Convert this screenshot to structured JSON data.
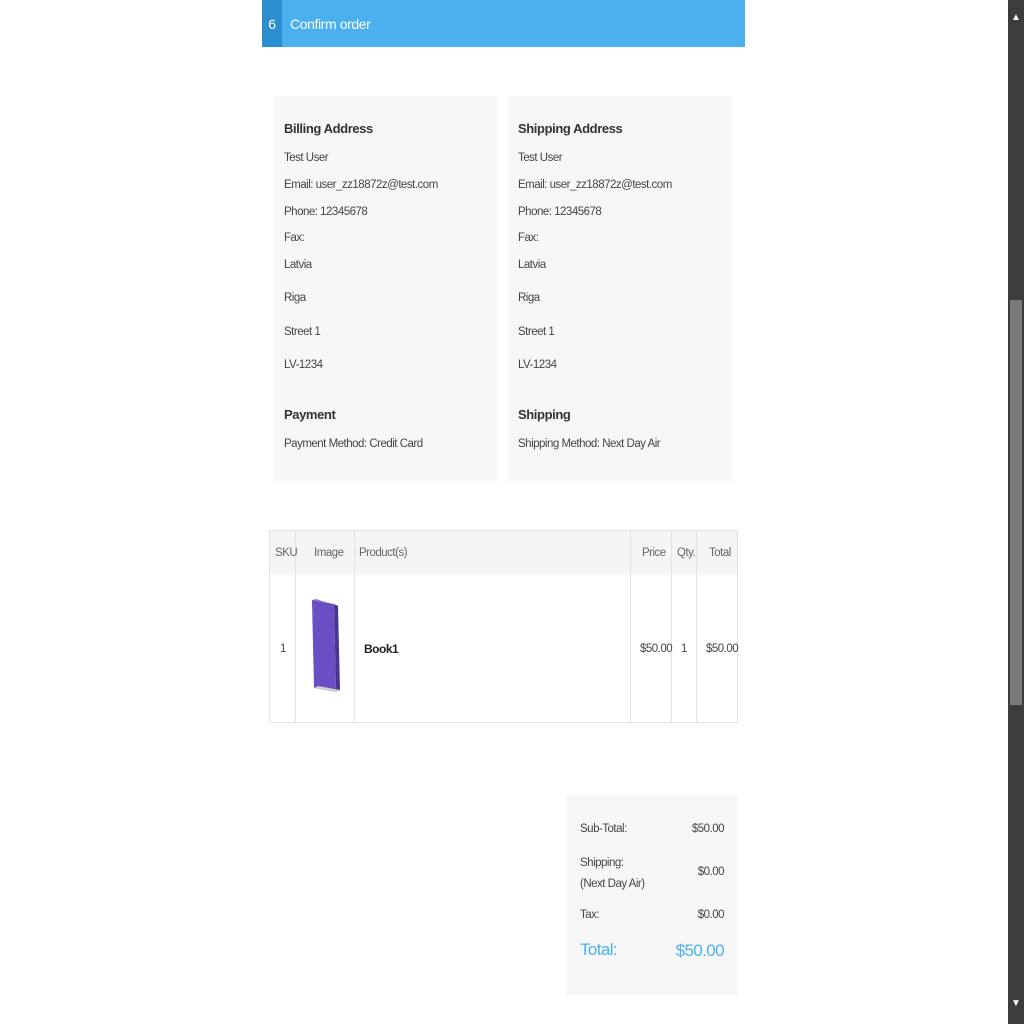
{
  "step": {
    "number": "6",
    "title": "Confirm order"
  },
  "billing": {
    "heading": "Billing Address",
    "name": "Test User",
    "email": "Email: user_zz18872z@test.com",
    "phone": "Phone: 12345678",
    "fax": "Fax:",
    "country": "Latvia",
    "city": "Riga",
    "street": "Street 1",
    "zip": "LV-1234"
  },
  "shipping_address": {
    "heading": "Shipping Address",
    "name": "Test User",
    "email": "Email: user_zz18872z@test.com",
    "phone": "Phone: 12345678",
    "fax": "Fax:",
    "country": "Latvia",
    "city": "Riga",
    "street": "Street 1",
    "zip": "LV-1234"
  },
  "payment": {
    "heading": "Payment",
    "method": "Payment Method: Credit Card"
  },
  "shipping": {
    "heading": "Shipping",
    "method": "Shipping Method: Next Day Air"
  },
  "table": {
    "headers": {
      "sku": "SKU",
      "image": "Image",
      "product": "Product(s)",
      "price": "Price",
      "qty": "Qty.",
      "total": "Total"
    },
    "rows": [
      {
        "sku": "1",
        "product": "Book1",
        "price": "$50.00",
        "qty": "1",
        "total": "$50.00"
      }
    ]
  },
  "totals": {
    "subtotal_label": "Sub-Total:",
    "subtotal_value": "$50.00",
    "shipping_label": "Shipping: (Next Day Air)",
    "shipping_value": "$0.00",
    "tax_label": "Tax:",
    "tax_value": "$0.00",
    "total_label": "Total:",
    "total_value": "$50.00"
  },
  "colors": {
    "accent": "#4ab1ee",
    "accent_dark": "#2b8ed1",
    "book": "#6a4fc4"
  },
  "icons": {
    "book": "book-icon",
    "scroll_up": "arrow-up-icon",
    "scroll_down": "arrow-down-icon"
  }
}
